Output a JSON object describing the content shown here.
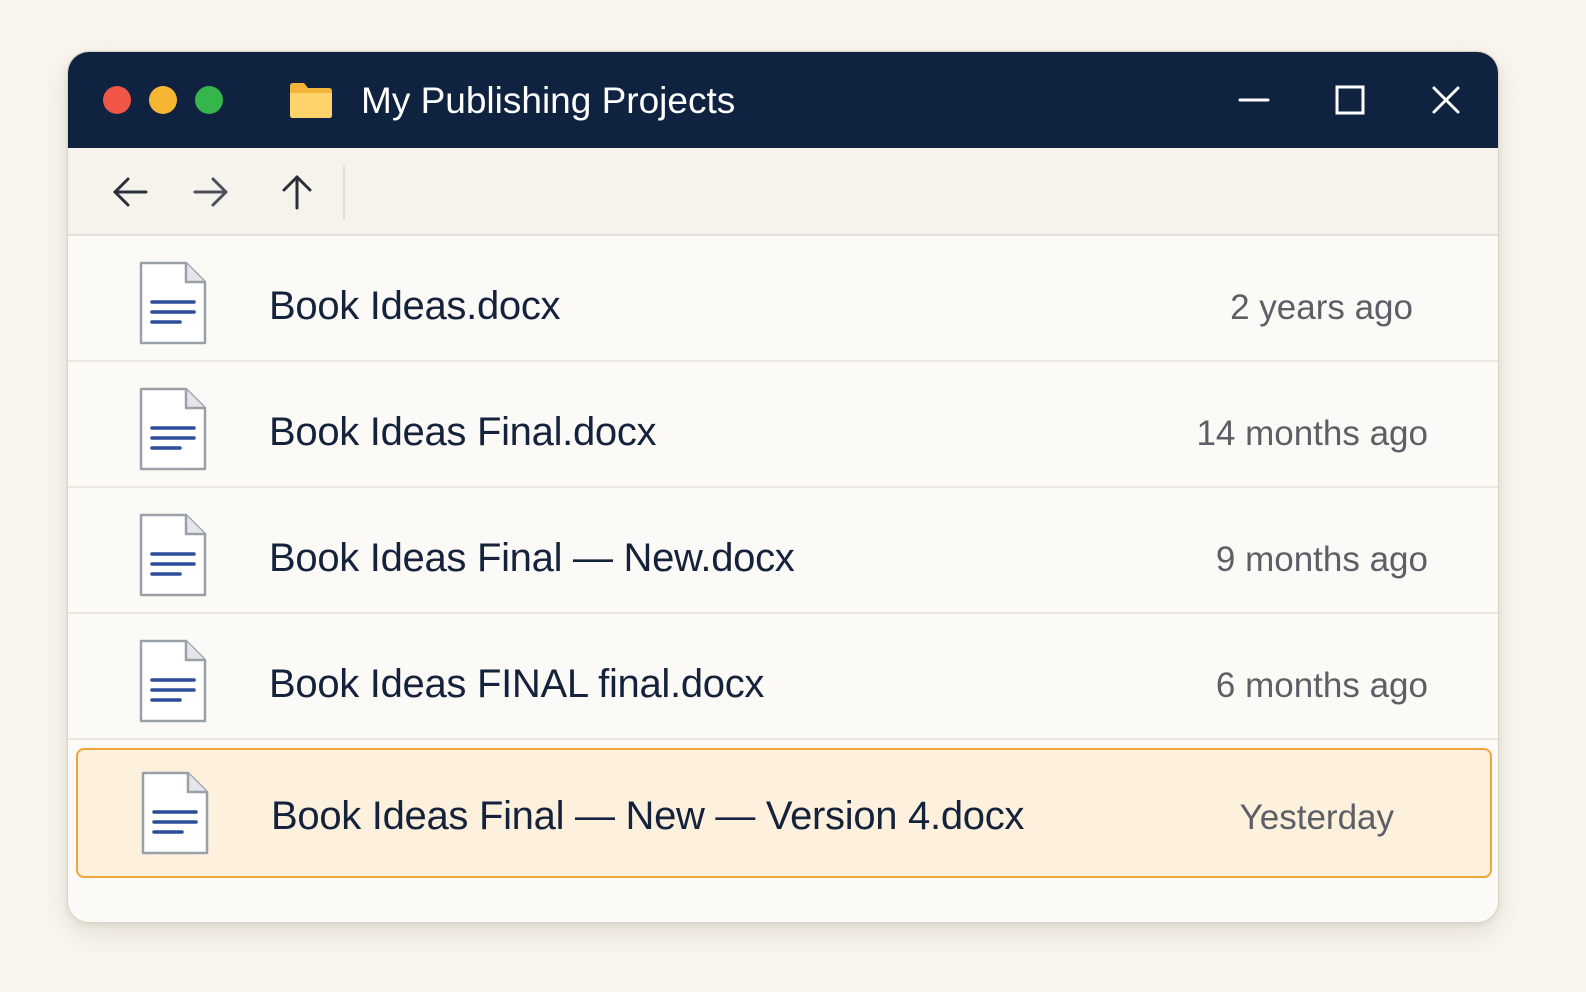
{
  "window": {
    "title": "My Publishing Projects",
    "title_icon": "folder-icon",
    "controls": {
      "close_color": "#f05545",
      "minimize_color": "#f5b731",
      "zoom_color": "#35b64a"
    },
    "buttons": [
      "minimize-icon",
      "maximize-icon",
      "close-icon"
    ]
  },
  "toolbar": {
    "nav": [
      "back-arrow-icon",
      "forward-arrow-icon",
      "up-arrow-icon"
    ]
  },
  "files": [
    {
      "name": "Book Ideas.docx",
      "modified": "2 years ago",
      "icon": "document-icon",
      "selected": false
    },
    {
      "name": "Book Ideas Final.docx",
      "modified": "14 months ago",
      "icon": "document-icon",
      "selected": false
    },
    {
      "name": "Book Ideas Final — New.docx",
      "modified": "9 months ago",
      "icon": "document-icon",
      "selected": false
    },
    {
      "name": "Book Ideas FINAL final.docx",
      "modified": "6 months ago",
      "icon": "document-icon",
      "selected": false
    },
    {
      "name": "Book Ideas Final — New — Version 4.docx",
      "modified": "Yesterday",
      "icon": "document-icon",
      "selected": true
    }
  ],
  "colors": {
    "titlebar": "#0f2240",
    "selection_border": "#f0a63a",
    "selection_fill": "#fdf0dc",
    "doc_lines": "#2b4d9a",
    "background": "#faf6ee"
  }
}
